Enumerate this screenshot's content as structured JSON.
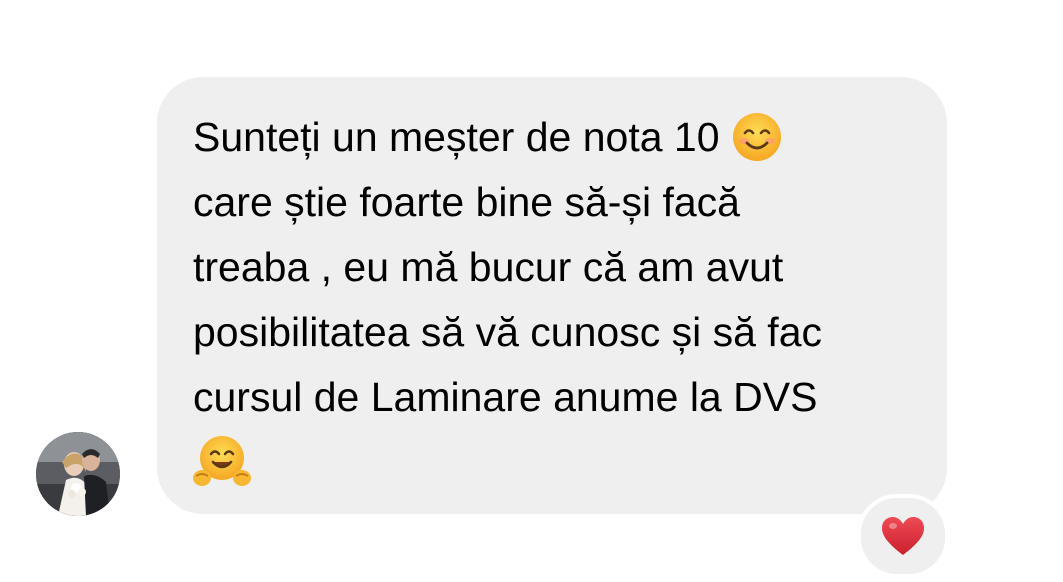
{
  "message": {
    "lines": [
      "Sunteți un meșter de nota 10",
      "care știe foarte bine să-și facă",
      "treaba , eu mă bucur că am avut",
      "posibilitatea să vă cunosc și să fac",
      "cursul de Laminare anume la DVS"
    ],
    "emoji_after_line1": "smiling-face-emoji",
    "emoji_last_line": "hugging-face-emoji"
  },
  "reaction": {
    "icon": "red-heart-icon",
    "color": "#e0313c"
  },
  "colors": {
    "bubble": "#efefef",
    "text": "#000000"
  }
}
